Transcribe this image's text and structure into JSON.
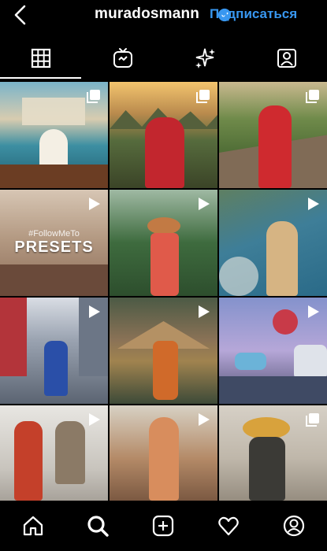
{
  "header": {
    "username": "muradosmann",
    "subscribe_label": "Подписаться",
    "back_icon": "chevron-left-icon",
    "verified_icon": "verified-badge-icon"
  },
  "tabs": [
    {
      "icon": "grid-icon",
      "active": true
    },
    {
      "icon": "igtv-icon",
      "active": false
    },
    {
      "icon": "effects-sparkles-icon",
      "active": false
    },
    {
      "icon": "tagged-user-icon",
      "active": false
    }
  ],
  "posts": [
    {
      "type": "carousel",
      "scene": "venice-canal-boat"
    },
    {
      "type": "carousel",
      "scene": "karst-mountains-red-dress"
    },
    {
      "type": "carousel",
      "scene": "great-wall-red-dress"
    },
    {
      "type": "video",
      "scene": "presets-promo",
      "hashtag": "#FollowMeTo",
      "text": "PRESETS"
    },
    {
      "type": "video",
      "scene": "palm-jungle-straw-hat"
    },
    {
      "type": "video",
      "scene": "cliff-ocean-view"
    },
    {
      "type": "video",
      "scene": "city-street-costume"
    },
    {
      "type": "video",
      "scene": "thatched-hut-headdress"
    },
    {
      "type": "video",
      "scene": "dessert-sky-installation"
    },
    {
      "type": "video",
      "scene": "office-red-dress"
    },
    {
      "type": "video",
      "scene": "sunset-forest"
    },
    {
      "type": "carousel",
      "scene": "kitchen-headdress"
    }
  ],
  "bottom_nav": [
    {
      "icon": "home-icon"
    },
    {
      "icon": "search-icon"
    },
    {
      "icon": "add-post-icon"
    },
    {
      "icon": "activity-heart-icon"
    },
    {
      "icon": "profile-icon"
    }
  ],
  "colors": {
    "background": "#000000",
    "link_blue": "#3897f0",
    "icon_white": "#ffffff"
  }
}
